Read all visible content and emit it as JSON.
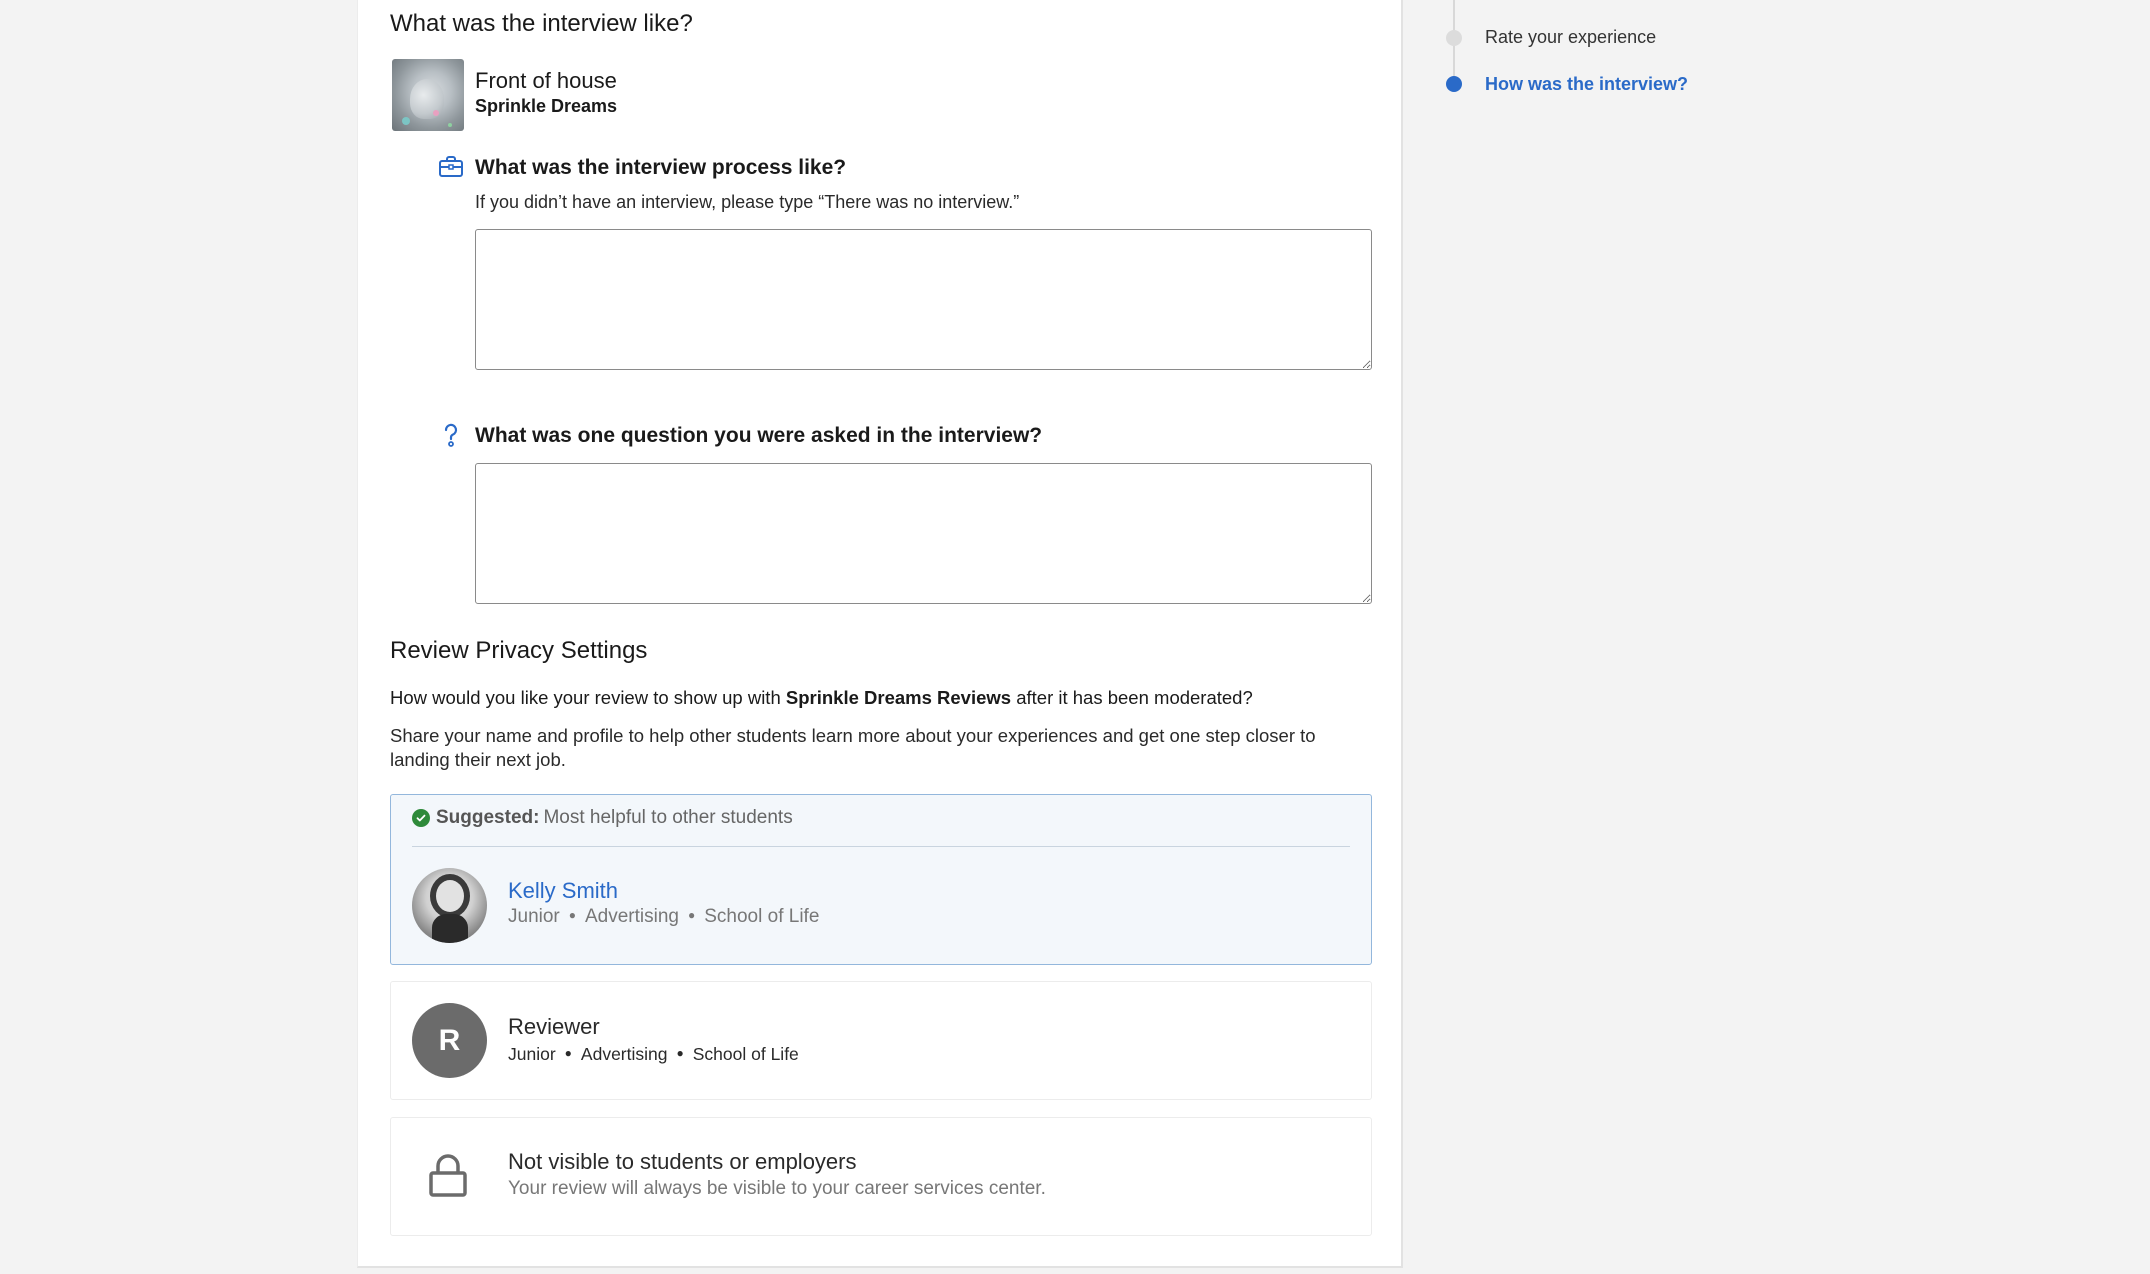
{
  "section": {
    "title": "What was the interview like?"
  },
  "job": {
    "title": "Front of house",
    "company": "Sprinkle Dreams"
  },
  "questions": [
    {
      "label": "What was the interview process like?",
      "help": "If you didn’t have an interview, please type “There was no interview.”",
      "value": "",
      "icon": "briefcase-icon"
    },
    {
      "label": "What was one question you were asked in the interview?",
      "value": "",
      "icon": "question-mark-icon"
    }
  ],
  "privacy": {
    "title": "Review Privacy Settings",
    "question_prefix": "How would you like your review to show up with ",
    "question_bold": "Sprinkle Dreams Reviews",
    "question_suffix": " after it has been moderated?",
    "description": "Share your name and profile to help other students learn more about your experiences and get one step closer to landing their next job.",
    "options": [
      {
        "suggested_label": "Suggested:",
        "suggested_note": "Most helpful to other students",
        "name": "Kelly Smith",
        "meta": [
          "Junior",
          "Advertising",
          "School of Life"
        ],
        "selected": true
      },
      {
        "avatar_letter": "R",
        "name": "Reviewer",
        "meta": [
          "Junior",
          "Advertising",
          "School of Life"
        ],
        "selected": false
      },
      {
        "name": "Not visible to students or employers",
        "note": "Your review will always be visible to your career services center.",
        "icon": "lock-icon",
        "selected": false
      }
    ]
  },
  "stepper": {
    "steps": [
      {
        "label": "Rate your experience",
        "state": "inactive"
      },
      {
        "label": "How was the interview?",
        "state": "active"
      }
    ]
  },
  "colors": {
    "accent": "#2a6ac8",
    "suggested_bg": "#f3f7fb",
    "suggested_border": "#93b7dc",
    "check_green": "#2e8a3a"
  }
}
